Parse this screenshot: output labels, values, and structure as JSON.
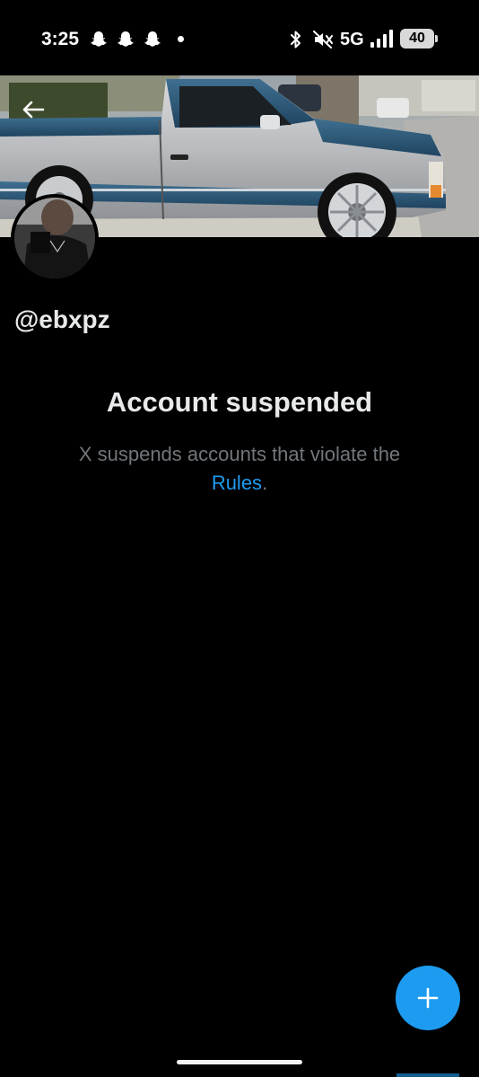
{
  "status_bar": {
    "time": "3:25",
    "network": "5G",
    "battery": "40",
    "notification_icons": [
      "snapchat-ghost-icon",
      "snapchat-ghost-icon",
      "snapchat-ghost-icon",
      "dot-icon"
    ],
    "system_icons": [
      "bluetooth-icon",
      "mute-icon",
      "signal-icon",
      "battery-icon"
    ]
  },
  "profile": {
    "handle": "@ebxpz",
    "banner_description": "",
    "avatar_icon": "avatar"
  },
  "suspension": {
    "title": "Account suspended",
    "description_prefix": "X suspends accounts that violate the",
    "rules_link": "Rules",
    "description_suffix": "."
  },
  "actions": {
    "back_icon": "back-arrow-icon",
    "fab_icon": "plus-icon"
  },
  "colors": {
    "accent": "#1d9bf0",
    "background": "#000000",
    "primary_text": "#e7e9ea",
    "secondary_text": "#71767b"
  }
}
